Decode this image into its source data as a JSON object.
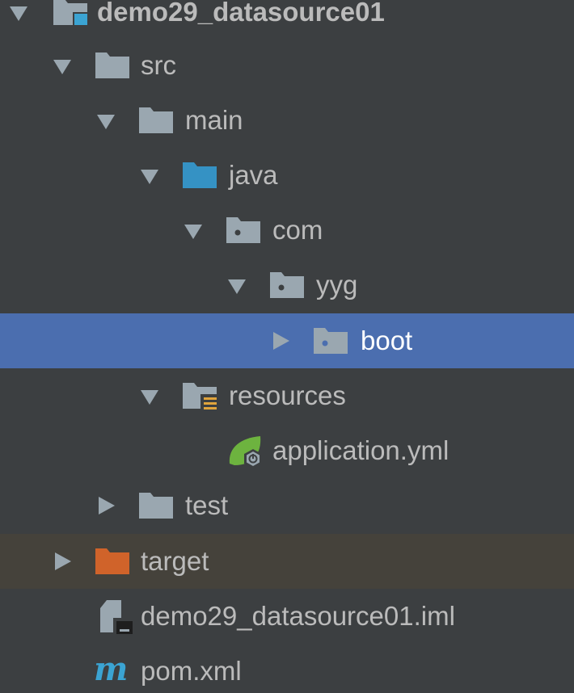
{
  "project_tree": {
    "root": {
      "label": "demo29_datasource01",
      "expanded": true,
      "icon": "module-folder-icon"
    },
    "src": {
      "label": "src",
      "expanded": true,
      "icon": "folder-icon"
    },
    "main": {
      "label": "main",
      "expanded": true,
      "icon": "folder-icon"
    },
    "java": {
      "label": "java",
      "expanded": true,
      "icon": "source-root-folder-icon"
    },
    "com": {
      "label": "com",
      "expanded": true,
      "icon": "package-icon"
    },
    "yyg": {
      "label": "yyg",
      "expanded": true,
      "icon": "package-icon"
    },
    "boot": {
      "label": "boot",
      "expanded": false,
      "selected": true,
      "icon": "package-icon"
    },
    "resources": {
      "label": "resources",
      "expanded": true,
      "icon": "resources-folder-icon"
    },
    "application_yml": {
      "label": "application.yml",
      "icon": "spring-config-file-icon"
    },
    "test": {
      "label": "test",
      "expanded": false,
      "icon": "folder-icon"
    },
    "target": {
      "label": "target",
      "expanded": false,
      "icon": "excluded-folder-icon"
    },
    "iml_file": {
      "label": "demo29_datasource01.iml",
      "icon": "iml-file-icon"
    },
    "pom_file": {
      "label": "pom.xml",
      "icon": "maven-icon"
    }
  },
  "colors": {
    "background": "#3c3f41",
    "selection": "#4b6eaf",
    "excluded_row": "#45423b",
    "text": "#bbbbbb",
    "folder": "#9aa7b0",
    "source_root": "#3592c4",
    "excluded_folder": "#d0632a",
    "maven": "#3ba4d3",
    "spring": "#6db33f"
  }
}
